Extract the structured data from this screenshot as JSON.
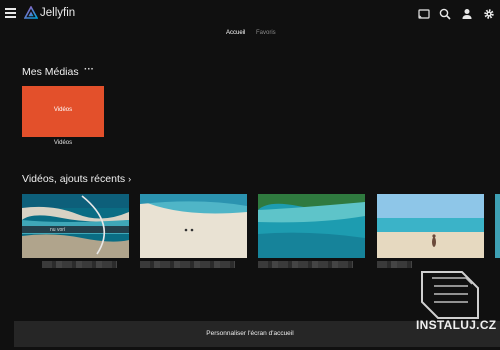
{
  "app": {
    "title": "Jellyfin"
  },
  "tabs": [
    {
      "label": "Accueil",
      "active": true
    },
    {
      "label": "Favoris",
      "active": false
    }
  ],
  "library_section": {
    "title": "Mes Médias",
    "items": [
      {
        "tile_label": "Vidéos",
        "caption": "Vidéos",
        "color": "#e3502b"
      }
    ]
  },
  "recent_section": {
    "title": "Vidéos, ajouts récents",
    "items": [
      {
        "overlay_text": "nu vorí"
      },
      {
        "overlay_text": ""
      },
      {
        "overlay_text": ""
      },
      {
        "overlay_text": ""
      }
    ]
  },
  "customize_button": {
    "label": "Personnaliser l'écran d'accueil"
  },
  "watermark": {
    "text": "INSTALUJ.CZ"
  },
  "icons": [
    "menu-icon",
    "jellyfin-logo-icon",
    "cast-icon",
    "search-icon",
    "user-icon",
    "settings-icon"
  ],
  "colors": {
    "background": "#101010",
    "accent": "#e3502b",
    "button_bg": "#262626"
  }
}
